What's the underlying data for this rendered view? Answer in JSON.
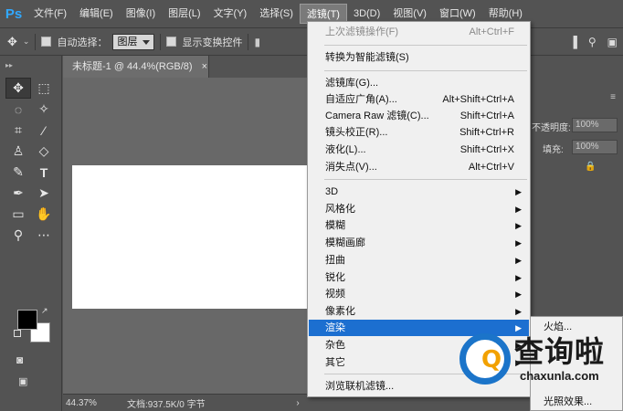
{
  "app": {
    "logo": "Ps"
  },
  "menubar": {
    "items": [
      "文件(F)",
      "编辑(E)",
      "图像(I)",
      "图层(L)",
      "文字(Y)",
      "选择(S)",
      "滤镜(T)",
      "3D(D)",
      "视图(V)",
      "窗口(W)",
      "帮助(H)"
    ],
    "active_index": 6
  },
  "options": {
    "auto_select_label": "自动选择：",
    "auto_select_value": "图层",
    "show_transform_label": "显示变换控件"
  },
  "document": {
    "tab_title": "未标题-1 @ 44.4%(RGB/8)",
    "tab_close": "×",
    "zoom": "44.37%",
    "status": "文档:937.5K/0 字节",
    "status_arrow": "›"
  },
  "right_panel": {
    "opacity_label": "不透明度:",
    "opacity_value": "100%",
    "fill_label": "填充:",
    "fill_value": "100%"
  },
  "filter_menu": {
    "items": [
      {
        "label": "上次滤镜操作(F)",
        "shortcut": "Alt+Ctrl+F",
        "disabled": true
      },
      {
        "label": "转换为智能滤镜(S)",
        "shortcut": ""
      },
      {
        "label": "滤镜库(G)...",
        "shortcut": ""
      },
      {
        "label": "自适应广角(A)...",
        "shortcut": "Alt+Shift+Ctrl+A"
      },
      {
        "label": "Camera Raw 滤镜(C)...",
        "shortcut": "Shift+Ctrl+A"
      },
      {
        "label": "镜头校正(R)...",
        "shortcut": "Shift+Ctrl+R"
      },
      {
        "label": "液化(L)...",
        "shortcut": "Shift+Ctrl+X"
      },
      {
        "label": "消失点(V)...",
        "shortcut": "Alt+Ctrl+V"
      },
      {
        "label": "3D",
        "submenu": true
      },
      {
        "label": "风格化",
        "submenu": true
      },
      {
        "label": "模糊",
        "submenu": true
      },
      {
        "label": "模糊画廊",
        "submenu": true
      },
      {
        "label": "扭曲",
        "submenu": true
      },
      {
        "label": "锐化",
        "submenu": true
      },
      {
        "label": "视频",
        "submenu": true
      },
      {
        "label": "像素化",
        "submenu": true
      },
      {
        "label": "渲染",
        "submenu": true,
        "highlighted": true
      },
      {
        "label": "杂色",
        "submenu": true
      },
      {
        "label": "其它",
        "submenu": true
      },
      {
        "label": "浏览联机滤镜...",
        "shortcut": ""
      }
    ]
  },
  "render_submenu": {
    "items": [
      "火焰...",
      "光照效果..."
    ]
  },
  "watermark": {
    "name": "查询啦",
    "url": "chaxunla.com",
    "glyph": "Q"
  },
  "colors": {
    "panel_bg": "#535353",
    "menu_bg": "#f0f0f0",
    "highlight": "#1c6fd0",
    "brand_blue": "#1b74c9",
    "brand_orange": "#f2a100"
  }
}
